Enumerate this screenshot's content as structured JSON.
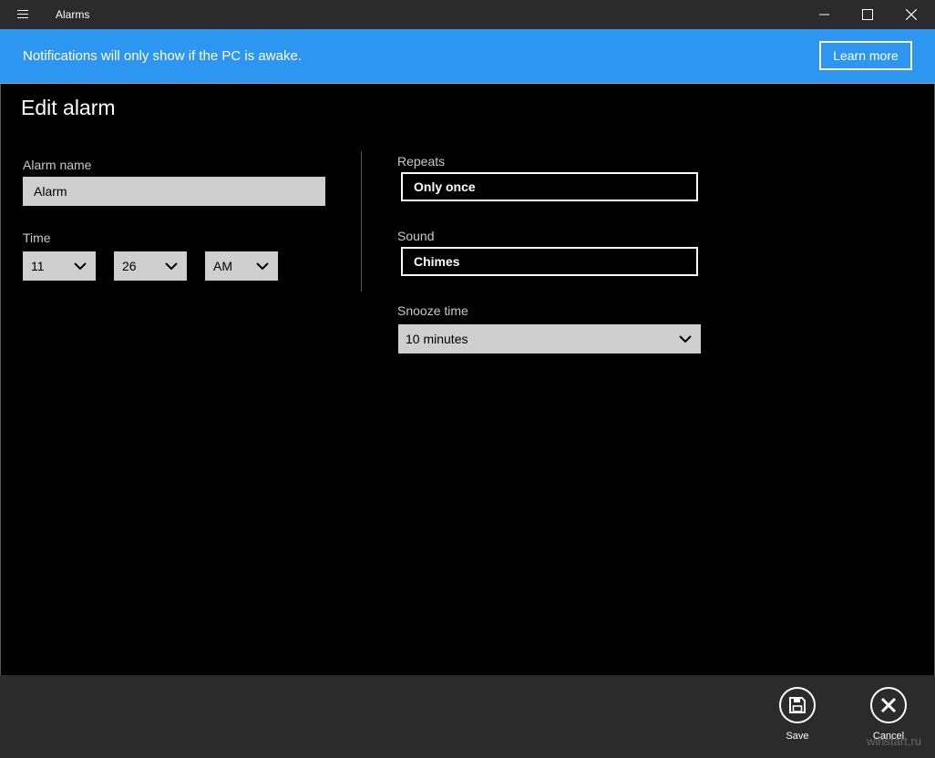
{
  "titlebar": {
    "app_title": "Alarms",
    "icons": [
      "hamburger-icon",
      "minimize-icon",
      "maximize-icon",
      "close-icon"
    ]
  },
  "notification": {
    "text": "Notifications will only show if the PC is awake.",
    "learn_more_label": "Learn more",
    "background": "#2d96f0"
  },
  "page": {
    "title": "Edit alarm"
  },
  "form": {
    "alarm_name_label": "Alarm name",
    "alarm_name_value": "Alarm",
    "time_label": "Time",
    "hour": "11",
    "minute": "26",
    "period": "AM",
    "repeats_label": "Repeats",
    "repeats_value": "Only once",
    "sound_label": "Sound",
    "sound_value": "Chimes",
    "snooze_label": "Snooze time",
    "snooze_value": "10 minutes"
  },
  "commands": {
    "save_label": "Save",
    "cancel_label": "Cancel"
  },
  "watermark": "winstart.ru"
}
